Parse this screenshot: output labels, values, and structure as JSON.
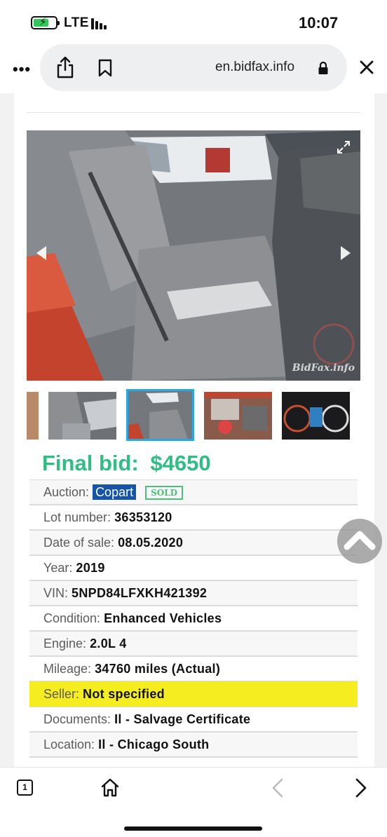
{
  "status_bar": {
    "network": "LTE",
    "time": "10:07"
  },
  "browser": {
    "url": "en.bidfax.info",
    "tab_count": "1"
  },
  "gallery": {
    "watermark": "BidFax.info"
  },
  "listing": {
    "final_bid_label": "Final bid:",
    "final_bid_value": "$4650",
    "rows": [
      {
        "label": "Auction:",
        "value": "Copart",
        "badge": "SOLD"
      },
      {
        "label": "Lot number:",
        "value": "36353120"
      },
      {
        "label": "Date of sale:",
        "value": "08.05.2020"
      },
      {
        "label": "Year:",
        "value": "2019"
      },
      {
        "label": "VIN:",
        "value": "5NPD84LFXKH421392"
      },
      {
        "label": "Condition:",
        "value": "Enhanced Vehicles"
      },
      {
        "label": "Engine:",
        "value": "2.0L 4"
      },
      {
        "label": "Mileage:",
        "value": "34760 miles (Actual)"
      },
      {
        "label": "Seller:",
        "value": "Not specified"
      },
      {
        "label": "Documents:",
        "value": "Il - Salvage Certificate"
      },
      {
        "label": "Location:",
        "value": "Il - Chicago South"
      }
    ]
  },
  "colors": {
    "final_bid": "#2fbd84",
    "seller_highlight": "#f5ed1f",
    "auction_tag": "#1654a8",
    "sold_badge": "#4cc07c",
    "thumb_active_border": "#2aa7e0"
  },
  "icons": [
    "battery-charging-icon",
    "signal-icon",
    "more-icon",
    "share-icon",
    "bookmark-icon",
    "lock-icon",
    "close-icon",
    "expand-icon",
    "chevron-up-icon",
    "tabs-icon",
    "home-icon",
    "back-icon",
    "forward-icon"
  ]
}
